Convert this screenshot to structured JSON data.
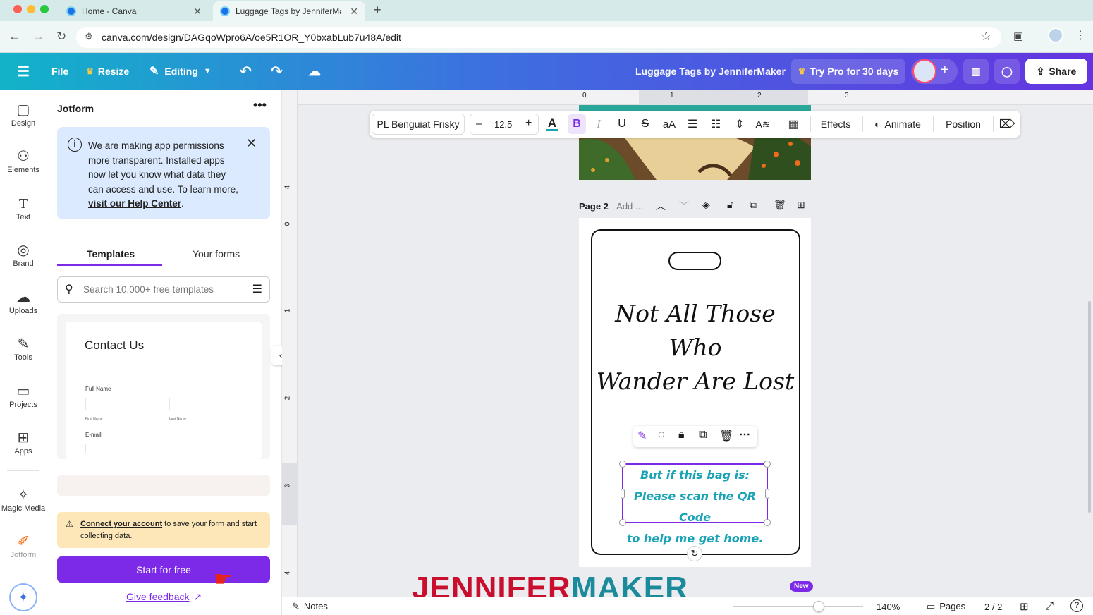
{
  "browser": {
    "tabs": [
      {
        "title": "Home - Canva"
      },
      {
        "title": "Luggage Tags by JenniferMak"
      }
    ],
    "url": "canva.com/design/DAGqoWpro6A/oe5R1OR_Y0bxabLub7u48A/edit"
  },
  "topbar": {
    "file_label": "File",
    "resize_label": "Resize",
    "editing_label": "Editing",
    "doc_title": "Luggage Tags by JenniferMaker",
    "try_pro_label": "Try Pro for 30 days",
    "share_label": "Share"
  },
  "rail": {
    "items": [
      {
        "label": "Design",
        "icon": "design-icon"
      },
      {
        "label": "Elements",
        "icon": "elements-icon"
      },
      {
        "label": "Text",
        "icon": "text-icon"
      },
      {
        "label": "Brand",
        "icon": "brand-icon"
      },
      {
        "label": "Uploads",
        "icon": "uploads-icon"
      },
      {
        "label": "Tools",
        "icon": "tools-icon"
      },
      {
        "label": "Projects",
        "icon": "projects-icon"
      },
      {
        "label": "Apps",
        "icon": "apps-icon"
      },
      {
        "label": "Magic Media",
        "icon": "magic-media-icon"
      },
      {
        "label": "Jotform",
        "icon": "jotform-icon"
      }
    ]
  },
  "panel": {
    "title": "Jotform",
    "notice_text": "We are making app permissions more transparent. Installed apps now let you know what data they can access and use. To learn more, ",
    "notice_link": "visit our Help Center",
    "notice_end": ".",
    "tabs": [
      "Templates",
      "Your forms"
    ],
    "search_placeholder": "Search 10,000+ free templates",
    "template": {
      "title": "Contact Us",
      "full_name_label": "Full Name",
      "first_name": "First Name",
      "last_name": "Last Name",
      "email_label": "E-mail"
    },
    "warning_link": "Connect your account",
    "warning_text": " to save your form and start collecting data.",
    "start_button": "Start for free",
    "feedback_link": "Give feedback"
  },
  "toolbar": {
    "font_name": "PL Benguiat Frisky",
    "font_size": "12.5",
    "effects_label": "Effects",
    "animate_label": "Animate",
    "position_label": "Position"
  },
  "ruler": {
    "top_ticks": [
      "0",
      "1",
      "2",
      "3"
    ],
    "left_ticks": [
      "4",
      "0",
      "1",
      "2",
      "3",
      "4"
    ]
  },
  "page": {
    "label": "Page 2",
    "add_title": "- Add ...",
    "headline_line1": "Not All Those Who",
    "headline_line2": "Wander Are Lost",
    "body_line1": "But if this bag is:",
    "body_line2": "Please scan the QR Code",
    "body_line3": "to help me get home."
  },
  "bottombar": {
    "notes_label": "Notes",
    "zoom": "140%",
    "pages_label": "Pages",
    "page_counter": "2 / 2",
    "new_badge": "New",
    "zoom_fraction": 0.66
  },
  "watermark": {
    "part1": "JENNIFER",
    "part2": "MAKER"
  },
  "colors": {
    "accent": "#7d2ae8",
    "teal_text": "#19a3b5",
    "notice_bg": "#dbeafe",
    "warning_bg": "#fde7b8"
  }
}
